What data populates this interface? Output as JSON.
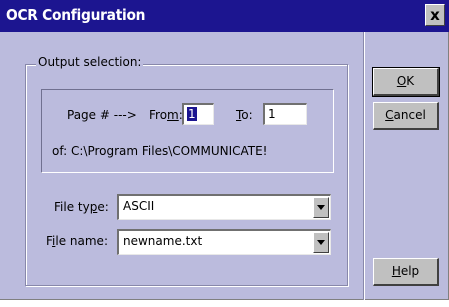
{
  "window": {
    "title": "OCR Configuration",
    "close_glyph": "x"
  },
  "output_selection": {
    "legend": "Output selection:",
    "page_label": "Page # --->",
    "from_label_pre": "Fro",
    "from_label_ul": "m",
    "from_label_post": ":",
    "from_value": "1",
    "to_label_ul": "T",
    "to_label_post": "o:",
    "to_value": "1",
    "source_path": "of: C:\\Program Files\\COMMUNICATE!"
  },
  "file_type": {
    "label_pre": "File ty",
    "label_ul": "p",
    "label_post": "e:",
    "value": "ASCII"
  },
  "file_name": {
    "label_pre": "F",
    "label_ul": "i",
    "label_post": "le name:",
    "value": "newname.txt"
  },
  "buttons": {
    "ok_ul": "O",
    "ok_post": "K",
    "cancel_ul": "C",
    "cancel_post": "ancel",
    "help_ul": "H",
    "help_post": "elp"
  }
}
